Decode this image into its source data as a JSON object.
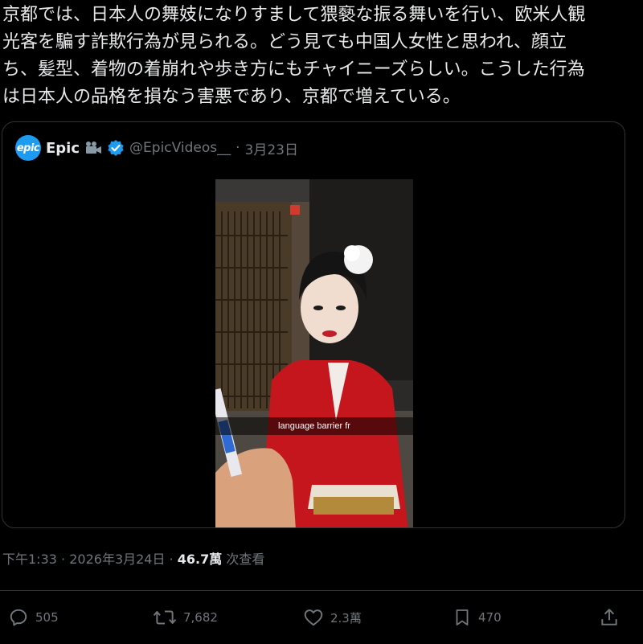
{
  "post": {
    "text": "京都では、日本人の舞妓になりすまして猥褻な振る舞いを行い、欧米人観\n光客を騙す詐欺行為が見られる。どう見ても中国人女性と思われ、顔立\nち、髪型、着物の着崩れや歩き方にもチャイニーズらしい。こうした行為\nは日本人の品格を損なう害悪であり、京都で増えている。"
  },
  "quote": {
    "avatar_text": "epic",
    "display_name": "Epic",
    "badge_icon": "movie-camera-icon",
    "verified_icon": "verified-badge-icon",
    "handle": "@EpicVideos__",
    "separator": "·",
    "date": "3月23日",
    "video": {
      "caption": "language barrier fr"
    }
  },
  "meta": {
    "time": "下午1:33",
    "separator": "·",
    "date": "2026年3月24日",
    "separator2": "·",
    "views_count": "46.7萬",
    "views_label": "次查看"
  },
  "actions": {
    "reply_count": "505",
    "repost_count": "7,682",
    "like_count": "2.3萬",
    "bookmark_count": "470"
  },
  "colors": {
    "background": "#000000",
    "text": "#e7e9ea",
    "secondary": "#71767b",
    "border": "#2f3336",
    "accent": "#1d9bf0"
  }
}
